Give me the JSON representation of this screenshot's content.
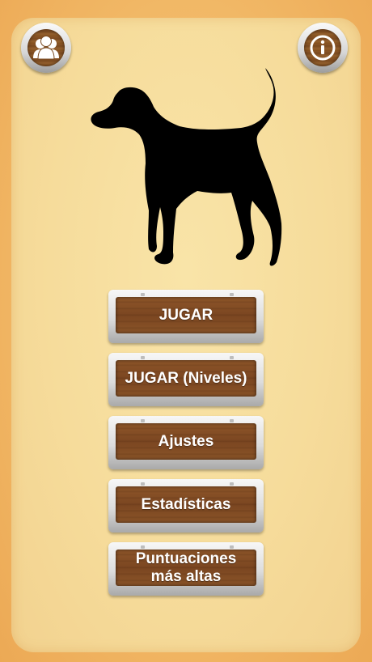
{
  "icons": {
    "users": "users-icon",
    "info": "info-icon",
    "dog": "dog-silhouette"
  },
  "colors": {
    "background": "#f2b462",
    "panel": "#f6dc9b",
    "wood": "#7b4621",
    "button_text": "#ffffff"
  },
  "menu": {
    "play": "JUGAR",
    "play_levels": "JUGAR (Niveles)",
    "settings": "Ajustes",
    "statistics": "Estadísticas",
    "high_scores_line1": "Puntuaciones",
    "high_scores_line2": "más altas"
  }
}
